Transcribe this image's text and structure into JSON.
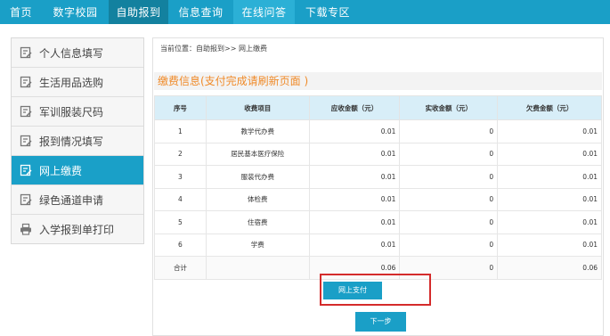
{
  "topnav": {
    "items": [
      "首页",
      "数字校园",
      "自助报到",
      "信息查询",
      "在线问答",
      "下载专区"
    ]
  },
  "sidebar": {
    "items": [
      {
        "label": "个人信息填写",
        "icon": "edit-icon"
      },
      {
        "label": "生活用品选购",
        "icon": "edit-icon"
      },
      {
        "label": "军训服装尺码",
        "icon": "edit-icon"
      },
      {
        "label": "报到情况填写",
        "icon": "edit-icon"
      },
      {
        "label": "网上缴费",
        "icon": "edit-icon"
      },
      {
        "label": "绿色通道申请",
        "icon": "edit-icon"
      },
      {
        "label": "入学报到单打印",
        "icon": "printer-icon"
      }
    ]
  },
  "main": {
    "breadcrumb": "当前位置：自助报到>> 网上缴费",
    "section_title": "缴费信息(支付完成请刷新页面 )",
    "table": {
      "headers": [
        "序号",
        "收费项目",
        "应收金额（元）",
        "实收金额（元）",
        "欠费金额（元）"
      ],
      "rows": [
        [
          "1",
          "教学代办费",
          "0.01",
          "0",
          "0.01"
        ],
        [
          "2",
          "居民基本医疗保险",
          "0.01",
          "0",
          "0.01"
        ],
        [
          "3",
          "服装代办费",
          "0.01",
          "0",
          "0.01"
        ],
        [
          "4",
          "体检费",
          "0.01",
          "0",
          "0.01"
        ],
        [
          "5",
          "住宿费",
          "0.01",
          "0",
          "0.01"
        ],
        [
          "6",
          "学费",
          "0.01",
          "0",
          "0.01"
        ]
      ],
      "total": [
        "合计",
        "",
        "0.06",
        "0",
        "0.06"
      ]
    },
    "pay_button": "网上支付",
    "next_button": "下一步"
  },
  "colors": {
    "primary": "#1a9fc7",
    "title_orange": "#f08a28",
    "highlight": "#d42b2b"
  }
}
